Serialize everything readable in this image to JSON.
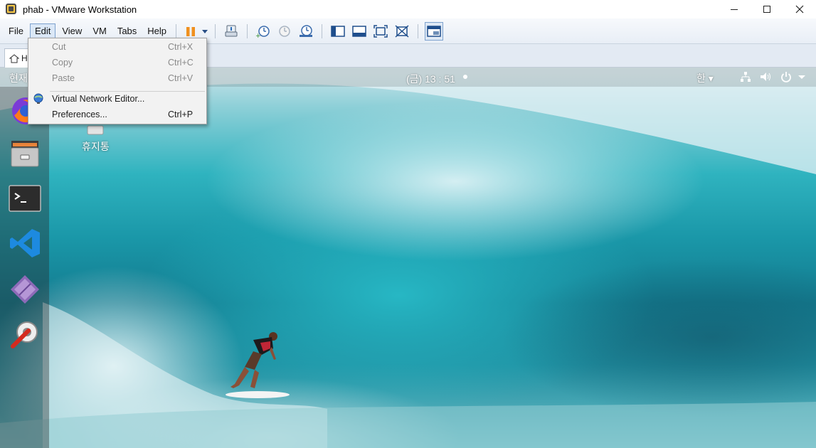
{
  "window": {
    "title": "phab - VMware Workstation",
    "controls": [
      "minimize-icon",
      "maximize-icon",
      "close-icon"
    ]
  },
  "menubar": {
    "items": [
      {
        "label": "File"
      },
      {
        "label": "Edit",
        "active": true
      },
      {
        "label": "View"
      },
      {
        "label": "VM"
      },
      {
        "label": "Tabs"
      },
      {
        "label": "Help"
      }
    ]
  },
  "toolbar": {
    "icons": [
      "pause-icon",
      "dropdown-arrow-icon",
      "send-ctrl-alt-del-icon",
      "take-snapshot-icon",
      "revert-snapshot-icon",
      "snapshot-manager-icon",
      "show-library-icon",
      "thumbnail-bar-icon",
      "full-screen-icon",
      "unity-icon",
      "console-view-icon"
    ]
  },
  "tabs": {
    "home_tab_label": "H"
  },
  "edit_menu": {
    "items": [
      {
        "label": "Cut",
        "shortcut": "Ctrl+X",
        "enabled": false
      },
      {
        "label": "Copy",
        "shortcut": "Ctrl+C",
        "enabled": false
      },
      {
        "label": "Paste",
        "shortcut": "Ctrl+V",
        "enabled": false
      },
      {
        "label": "Virtual Network Editor...",
        "shortcut": "",
        "enabled": true,
        "icon": "globe-network-icon"
      },
      {
        "label": "Preferences...",
        "shortcut": "Ctrl+P",
        "enabled": true
      }
    ]
  },
  "guest": {
    "activities_label": "현재",
    "clock": "(금) 13 : 51",
    "input_method": "한",
    "tray_icons": [
      "network-icon",
      "volume-icon",
      "power-icon",
      "tray-menu-arrow-icon"
    ],
    "desktop_icons": [
      {
        "label": "휴지통",
        "icon": "trash-icon"
      }
    ],
    "dock_apps": [
      "firefox-icon",
      "file-cabinet-icon",
      "terminal-icon",
      "vscode-icon",
      "diamond-app-icon",
      "settings-tools-icon"
    ]
  },
  "colors": {
    "menu_active_bg": "#dbe8f7",
    "menu_active_border": "#7da2ce",
    "pause_orange": "#f0901e",
    "wave_teal": "#1a97a8"
  }
}
